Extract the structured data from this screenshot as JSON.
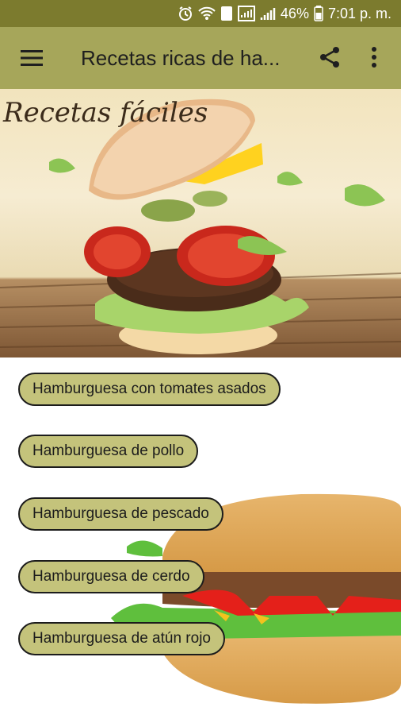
{
  "status": {
    "battery_percent": "46%",
    "time": "7:01 p. m.",
    "sim_badge": "1"
  },
  "app_bar": {
    "title": "Recetas ricas de ha..."
  },
  "hero": {
    "overlay_text": "Recetas fáciles"
  },
  "recipes": [
    {
      "label": "Hamburguesa con tomates asados"
    },
    {
      "label": "Hamburguesa de pollo"
    },
    {
      "label": "Hamburguesa de pescado"
    },
    {
      "label": "Hamburguesa de cerdo"
    },
    {
      "label": "Hamburguesa de atún rojo"
    }
  ],
  "colors": {
    "status_bar": "#7c7b2e",
    "app_bar": "#a6a65a",
    "button_fill": "#c4c37b"
  },
  "icons": {
    "menu": "menu-icon",
    "share": "share-icon",
    "more": "more-vert-icon"
  }
}
